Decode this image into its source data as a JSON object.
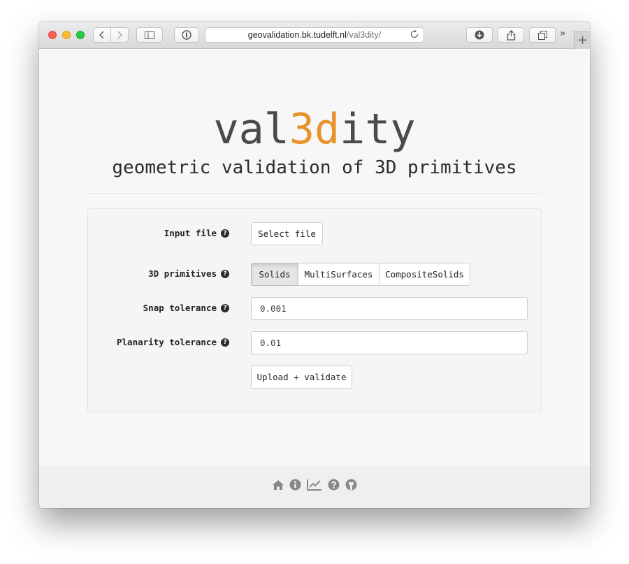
{
  "browser": {
    "url_host": "geovalidation.bk.tudelft.nl",
    "url_path": "/val3dity/",
    "more_glyph": "»",
    "new_tab_glyph": "+"
  },
  "header": {
    "logo_pre": "val",
    "logo_accent": "3d",
    "logo_post": "ity",
    "tagline": "geometric validation of 3D primitives"
  },
  "form": {
    "input_file_label": "Input file",
    "select_file_button": "Select file",
    "primitives_label": "3D primitives",
    "primitives_options": [
      "Solids",
      "MultiSurfaces",
      "CompositeSolids"
    ],
    "primitives_selected": "Solids",
    "snap_label": "Snap tolerance",
    "snap_value": "0.001",
    "planarity_label": "Planarity tolerance",
    "planarity_value": "0.01",
    "submit_button": "Upload + validate"
  },
  "footer": {
    "icons": [
      "home-icon",
      "info-icon",
      "chart-icon",
      "question-icon",
      "github-icon"
    ]
  },
  "colors": {
    "accent": "#e8922a",
    "logo_text": "#4a4a4a",
    "page_bg": "#f7f7f7"
  }
}
